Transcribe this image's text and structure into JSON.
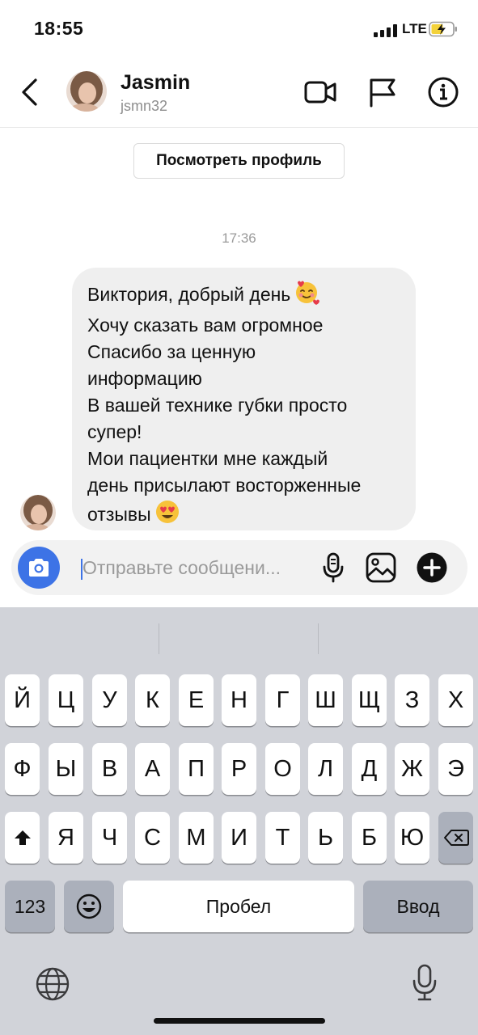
{
  "status_bar": {
    "time": "18:55",
    "network": "LTE"
  },
  "header": {
    "name": "Jasmin",
    "username": "jsmn32"
  },
  "profile_button_label": "Посмотреть профиль",
  "timestamp": "17:36",
  "message": {
    "lines": [
      "Виктория, добрый день",
      "Хочу сказать вам огромное",
      "Спасибо за ценную",
      "информацию",
      "В  вашей технике губки просто",
      "супер!",
      "Мои пациентки мне каждый",
      "день присылают восторженные",
      "отзывы"
    ],
    "emoji_line0": "🥰",
    "emoji_line8": "😍"
  },
  "composer": {
    "placeholder": "Отправьте сообщени..."
  },
  "keyboard": {
    "row1": [
      "Й",
      "Ц",
      "У",
      "К",
      "Е",
      "Н",
      "Г",
      "Ш",
      "Щ",
      "З",
      "Х"
    ],
    "row2": [
      "Ф",
      "Ы",
      "В",
      "А",
      "П",
      "Р",
      "О",
      "Л",
      "Д",
      "Ж",
      "Э"
    ],
    "row3": [
      "Я",
      "Ч",
      "С",
      "М",
      "И",
      "Т",
      "Ь",
      "Б",
      "Ю"
    ],
    "numbers_key": "123",
    "space_key": "Пробел",
    "return_key": "Ввод"
  },
  "colors": {
    "accent": "#3d73e6",
    "bubble": "#efefef",
    "keyboard_bg": "#d1d3d9"
  },
  "icons": [
    "back-icon",
    "video-call-icon",
    "flag-icon",
    "info-icon",
    "camera-icon",
    "microphone-icon",
    "gallery-icon",
    "add-icon",
    "shift-icon",
    "backspace-icon",
    "emoji-icon",
    "globe-icon",
    "dictation-icon"
  ]
}
